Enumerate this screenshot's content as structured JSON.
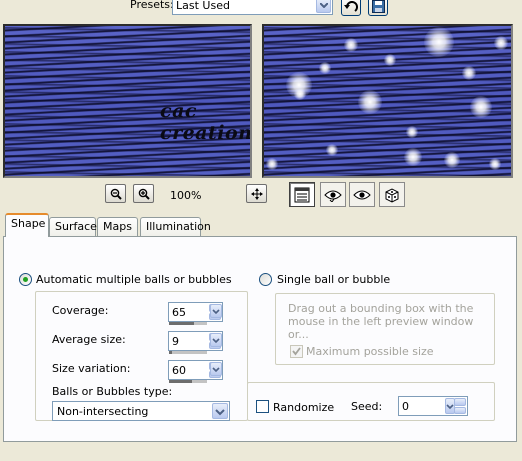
{
  "presets": {
    "label": "Presets:",
    "value": "Last Used"
  },
  "preview": {
    "watermark": "cac creations",
    "zoom_label": "100%"
  },
  "tabs": [
    {
      "label": "Shape",
      "active": true
    },
    {
      "label": "Surface",
      "active": false
    },
    {
      "label": "Maps",
      "active": false
    },
    {
      "label": "Illumination",
      "active": false
    }
  ],
  "shape": {
    "auto_radio_label": "Automatic multiple balls or bubbles",
    "auto_selected": true,
    "single_radio_label": "Single ball or bubble",
    "coverage": {
      "label": "Coverage:",
      "value": "65"
    },
    "average_size": {
      "label": "Average size:",
      "value": "9"
    },
    "size_variation": {
      "label": "Size variation:",
      "value": "60"
    },
    "type_label": "Balls or Bubbles type:",
    "type_value": "Non-intersecting",
    "single_hint": "Drag out a bounding box with the mouse in the left preview window or...",
    "max_size_label": "Maximum possible size",
    "max_size_checked": true,
    "randomize_label": "Randomize",
    "randomize_checked": false,
    "seed_label": "Seed:",
    "seed_value": "0"
  },
  "colors": {
    "window_bg": "#ece9d8",
    "tab_accent": "#e68b2c",
    "radio_dot": "#21a121"
  }
}
